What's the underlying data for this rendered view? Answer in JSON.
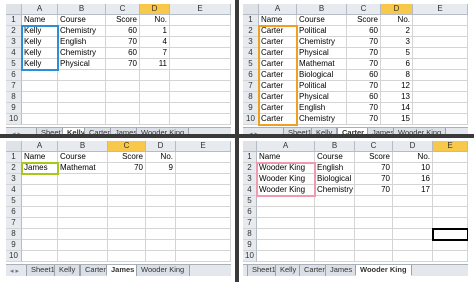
{
  "colors": {
    "kelly_highlight": "#2a8fd6",
    "carter_highlight": "#f0a020",
    "james_highlight": "#a6c71e",
    "wooder_highlight": "#ef9ab0",
    "header_selected": "#f8c84a"
  },
  "nav_icons": "◂ ▸",
  "panels": {
    "kelly": {
      "sheet": "Kelly",
      "columns": [
        "A",
        "B",
        "C",
        "D",
        "E"
      ],
      "selected_col": "D",
      "rows": [
        {
          "n": "1",
          "a": "Name",
          "b": "Course",
          "c": "Score",
          "d": "No.",
          "e": ""
        },
        {
          "n": "2",
          "a": "Kelly",
          "b": "Chemistry",
          "c": "60",
          "d": "1",
          "e": ""
        },
        {
          "n": "3",
          "a": "Kelly",
          "b": "English",
          "c": "70",
          "d": "4",
          "e": ""
        },
        {
          "n": "4",
          "a": "Kelly",
          "b": "Chemistry",
          "c": "60",
          "d": "7",
          "e": ""
        },
        {
          "n": "5",
          "a": "Kelly",
          "b": "Physical",
          "c": "70",
          "d": "11",
          "e": ""
        },
        {
          "n": "6",
          "a": "",
          "b": "",
          "c": "",
          "d": "",
          "e": ""
        },
        {
          "n": "7",
          "a": "",
          "b": "",
          "c": "",
          "d": "",
          "e": ""
        },
        {
          "n": "8",
          "a": "",
          "b": "",
          "c": "",
          "d": "",
          "e": ""
        },
        {
          "n": "9",
          "a": "",
          "b": "",
          "c": "",
          "d": "",
          "e": ""
        },
        {
          "n": "10",
          "a": "",
          "b": "",
          "c": "",
          "d": "",
          "e": ""
        }
      ],
      "tabs": [
        "Sheet1",
        "Kelly",
        "Carter",
        "James",
        "Wooder King"
      ],
      "active_tab": 1
    },
    "carter": {
      "sheet": "Carter",
      "columns": [
        "A",
        "B",
        "C",
        "D",
        "E"
      ],
      "selected_col": "D",
      "rows": [
        {
          "n": "1",
          "a": "Name",
          "b": "Course",
          "c": "Score",
          "d": "No.",
          "e": ""
        },
        {
          "n": "2",
          "a": "Carter",
          "b": "Political",
          "c": "60",
          "d": "2",
          "e": ""
        },
        {
          "n": "3",
          "a": "Carter",
          "b": "Chemistry",
          "c": "70",
          "d": "3",
          "e": ""
        },
        {
          "n": "4",
          "a": "Carter",
          "b": "Physical",
          "c": "70",
          "d": "5",
          "e": ""
        },
        {
          "n": "5",
          "a": "Carter",
          "b": "Mathemat",
          "c": "70",
          "d": "6",
          "e": ""
        },
        {
          "n": "6",
          "a": "Carter",
          "b": "Biological",
          "c": "60",
          "d": "8",
          "e": ""
        },
        {
          "n": "7",
          "a": "Carter",
          "b": "Political",
          "c": "70",
          "d": "12",
          "e": ""
        },
        {
          "n": "8",
          "a": "Carter",
          "b": "Physical",
          "c": "60",
          "d": "13",
          "e": ""
        },
        {
          "n": "9",
          "a": "Carter",
          "b": "English",
          "c": "70",
          "d": "14",
          "e": ""
        },
        {
          "n": "10",
          "a": "Carter",
          "b": "Chemistry",
          "c": "70",
          "d": "15",
          "e": ""
        }
      ],
      "tabs": [
        "Sheet1",
        "Kelly",
        "Carter",
        "James",
        "Wooder King"
      ],
      "active_tab": 2
    },
    "james": {
      "sheet": "James",
      "columns": [
        "A",
        "B",
        "C",
        "D",
        "E"
      ],
      "selected_col": "C",
      "rows": [
        {
          "n": "1",
          "a": "Name",
          "b": "Course",
          "c": "Score",
          "d": "No.",
          "e": ""
        },
        {
          "n": "2",
          "a": "James",
          "b": "Mathemat",
          "c": "70",
          "d": "9",
          "e": ""
        },
        {
          "n": "3",
          "a": "",
          "b": "",
          "c": "",
          "d": "",
          "e": ""
        },
        {
          "n": "4",
          "a": "",
          "b": "",
          "c": "",
          "d": "",
          "e": ""
        },
        {
          "n": "5",
          "a": "",
          "b": "",
          "c": "",
          "d": "",
          "e": ""
        },
        {
          "n": "6",
          "a": "",
          "b": "",
          "c": "",
          "d": "",
          "e": ""
        },
        {
          "n": "7",
          "a": "",
          "b": "",
          "c": "",
          "d": "",
          "e": ""
        },
        {
          "n": "8",
          "a": "",
          "b": "",
          "c": "",
          "d": "",
          "e": ""
        },
        {
          "n": "9",
          "a": "",
          "b": "",
          "c": "",
          "d": "",
          "e": ""
        },
        {
          "n": "10",
          "a": "",
          "b": "",
          "c": "",
          "d": "",
          "e": ""
        }
      ],
      "tabs": [
        "Sheet1",
        "Kelly",
        "Carter",
        "James",
        "Wooder King"
      ],
      "active_tab": 3
    },
    "wooder": {
      "sheet": "Wooder King",
      "columns": [
        "A",
        "B",
        "C",
        "D",
        "E"
      ],
      "selected_col": "E",
      "rows": [
        {
          "n": "1",
          "a": "Name",
          "b": "Course",
          "c": "Score",
          "d": "No.",
          "e": ""
        },
        {
          "n": "2",
          "a": "Wooder King",
          "b": "English",
          "c": "70",
          "d": "10",
          "e": ""
        },
        {
          "n": "3",
          "a": "Wooder King",
          "b": "Biological",
          "c": "70",
          "d": "16",
          "e": ""
        },
        {
          "n": "4",
          "a": "Wooder King",
          "b": "Chemistry",
          "c": "70",
          "d": "17",
          "e": ""
        },
        {
          "n": "5",
          "a": "",
          "b": "",
          "c": "",
          "d": "",
          "e": ""
        },
        {
          "n": "6",
          "a": "",
          "b": "",
          "c": "",
          "d": "",
          "e": ""
        },
        {
          "n": "7",
          "a": "",
          "b": "",
          "c": "",
          "d": "",
          "e": ""
        },
        {
          "n": "8",
          "a": "",
          "b": "",
          "c": "",
          "d": "",
          "e": ""
        },
        {
          "n": "9",
          "a": "",
          "b": "",
          "c": "",
          "d": "",
          "e": ""
        },
        {
          "n": "10",
          "a": "",
          "b": "",
          "c": "",
          "d": "",
          "e": ""
        }
      ],
      "tabs": [
        "Sheet1",
        "Kelly",
        "Carter",
        "James",
        "Wooder King"
      ],
      "active_tab": 4
    }
  }
}
